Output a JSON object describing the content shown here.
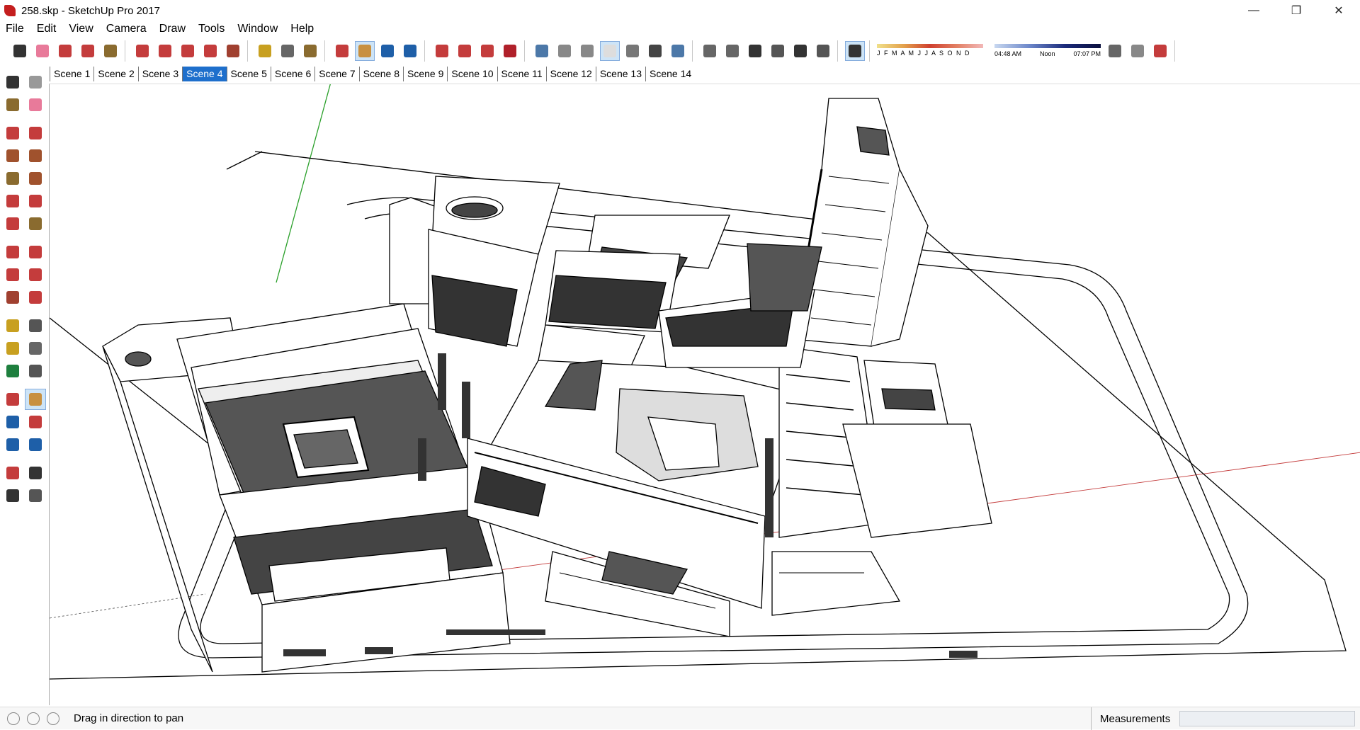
{
  "window": {
    "title": "258.skp - SketchUp Pro 2017",
    "minimize": "—",
    "maximize": "❐",
    "close": "✕"
  },
  "menu": [
    "File",
    "Edit",
    "View",
    "Camera",
    "Draw",
    "Tools",
    "Window",
    "Help"
  ],
  "toolbar": {
    "groups": [
      [
        "select-icon",
        "eraser-icon",
        "pencil-icon",
        "arc-icon",
        "paint-bucket-icon"
      ],
      [
        "push-pull-icon",
        "offset-icon",
        "move-icon",
        "rotate-icon",
        "scale-icon"
      ],
      [
        "tape-measure-icon",
        "text-icon",
        "paint-icon"
      ],
      [
        "orbit-icon",
        "pan-icon",
        "zoom-icon",
        "zoom-extents-icon"
      ],
      [
        "warehouse-icon",
        "extension-icon",
        "sketchup-icon",
        "ruby-icon"
      ],
      [
        "xray-icon",
        "back-edges-icon",
        "wireframe-icon",
        "hidden-line-icon",
        "shaded-icon",
        "textured-icon",
        "monochrome-icon"
      ],
      [
        "iso-view-icon",
        "top-view-icon",
        "front-view-icon",
        "right-view-icon",
        "back-view-icon",
        "left-view-icon"
      ],
      [
        "shadow-toggle-icon"
      ]
    ],
    "active_tool": "pan-icon",
    "shadow": {
      "months": "J F M A M J J A S O N D",
      "time_start": "04:48 AM",
      "time_mid": "Noon",
      "time_end": "07:07 PM"
    }
  },
  "scenes": {
    "tabs": [
      "Scene 1",
      "Scene 2",
      "Scene 3",
      "Scene 4",
      "Scene 5",
      "Scene 6",
      "Scene 7",
      "Scene 8",
      "Scene 9",
      "Scene 10",
      "Scene 11",
      "Scene 12",
      "Scene 13",
      "Scene 14"
    ],
    "active_index": 3
  },
  "left_tools": [
    [
      "select-icon",
      "component-icon"
    ],
    [
      "paint-bucket-icon",
      "eraser-icon"
    ],
    [
      "line-icon",
      "freehand-icon"
    ],
    [
      "rectangle-icon",
      "rotated-rectangle-icon"
    ],
    [
      "circle-icon",
      "polygon-icon"
    ],
    [
      "arc-icon",
      "two-point-arc-icon"
    ],
    [
      "three-point-arc-icon",
      "pie-icon"
    ],
    [
      "move-icon",
      "push-pull-icon"
    ],
    [
      "rotate-icon",
      "follow-me-icon"
    ],
    [
      "scale-icon",
      "offset-icon"
    ],
    [
      "tape-measure-icon",
      "dimension-icon"
    ],
    [
      "protractor-icon",
      "text-icon"
    ],
    [
      "axes-icon",
      "3d-text-icon"
    ],
    [
      "orbit-icon",
      "pan-icon"
    ],
    [
      "zoom-icon",
      "zoom-window-icon"
    ],
    [
      "zoom-extents-icon",
      "previous-view-icon"
    ],
    [
      "position-camera-icon",
      "look-around-icon"
    ],
    [
      "walk-icon",
      "section-plane-icon"
    ]
  ],
  "status": {
    "hint": "Drag in direction to pan",
    "measurements_label": "Measurements",
    "measurements_value": ""
  },
  "colors": {
    "accent": "#1e6fcc",
    "axis_red": "#c43c3c",
    "axis_green": "#2aa02a",
    "active_tool_bg": "#cde4f7"
  }
}
